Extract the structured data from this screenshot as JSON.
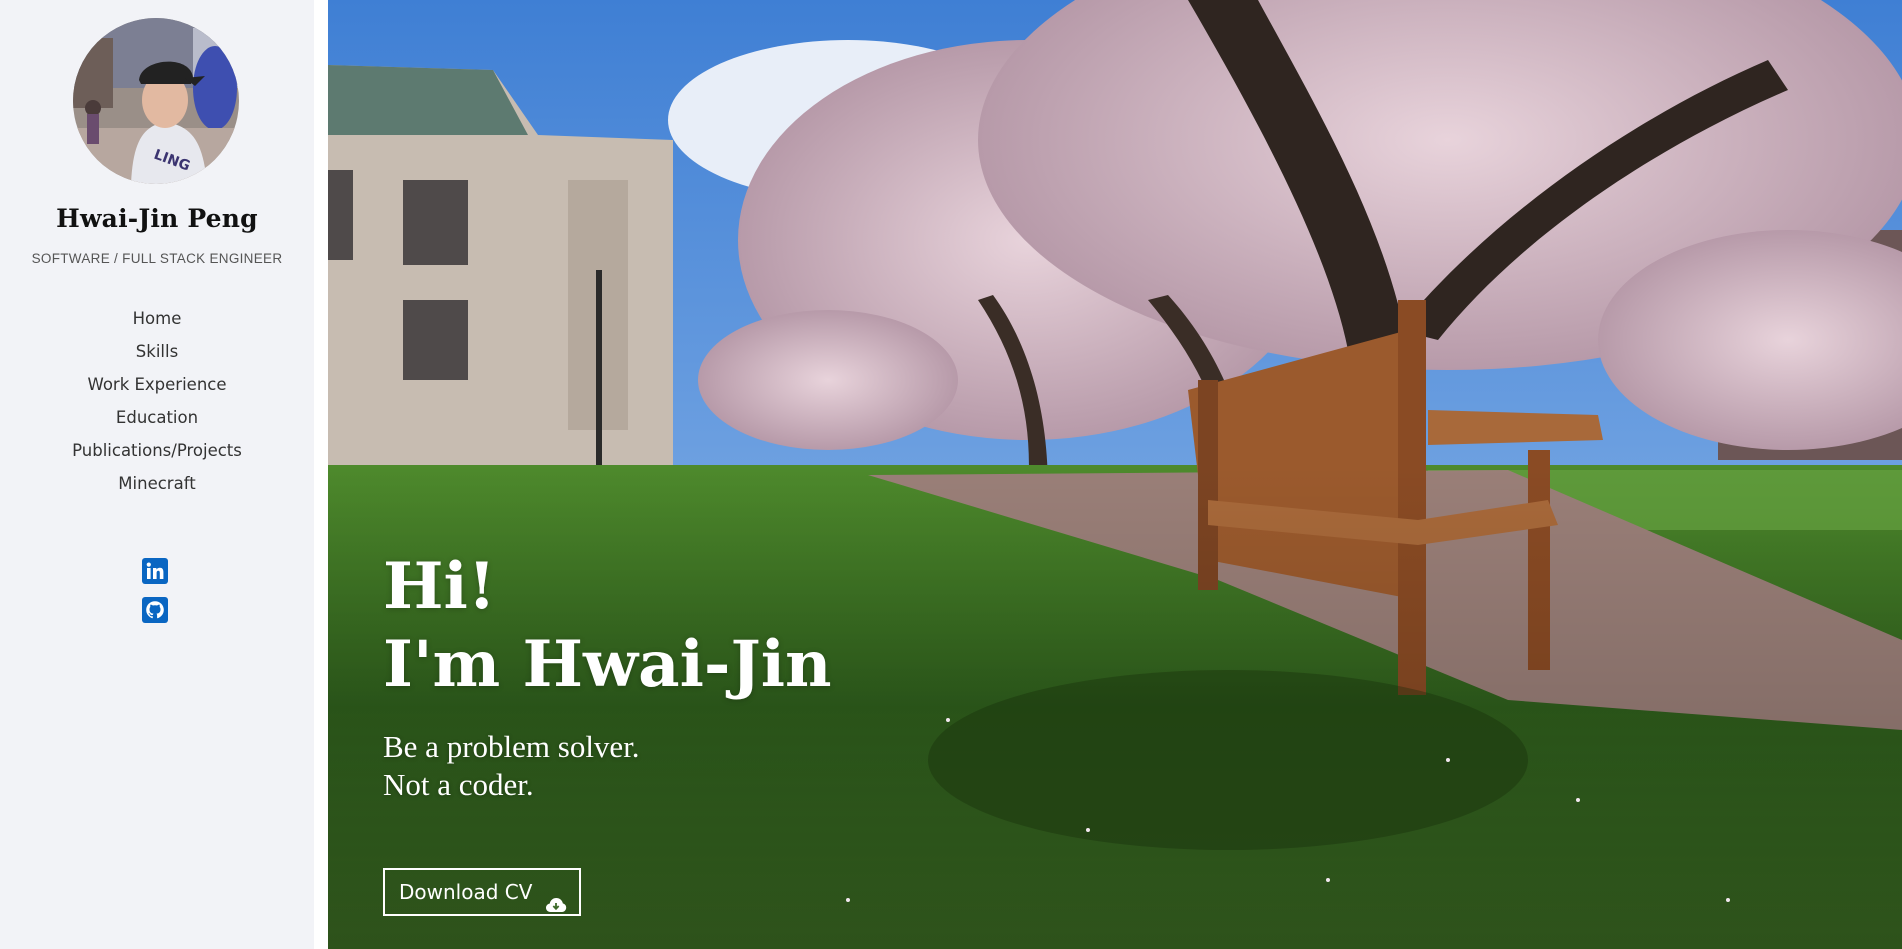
{
  "profile": {
    "name": "Hwai-Jin Peng",
    "subtitle": "SOFTWARE / FULL STACK ENGINEER",
    "avatar_icon": "profile-photo"
  },
  "nav": {
    "items": [
      {
        "label": "Home"
      },
      {
        "label": "Skills"
      },
      {
        "label": "Work Experience"
      },
      {
        "label": "Education"
      },
      {
        "label": "Publications/Projects"
      },
      {
        "label": "Minecraft"
      }
    ]
  },
  "socials": [
    {
      "icon": "linkedin-icon",
      "color": "#0a66c2"
    },
    {
      "icon": "github-icon",
      "color": "#0a66c2"
    }
  ],
  "hero": {
    "greeting_line1": "Hi!",
    "greeting_line2": "I'm Hwai-Jin",
    "motto_line1": "Be a problem solver.",
    "motto_line2": "Not a coder.",
    "download_label": "Download CV",
    "download_icon": "cloud-download-icon"
  },
  "colors": {
    "sidebar_bg": "#f2f3f7",
    "accent": "#0a66c2",
    "hero_text": "#ffffff"
  }
}
